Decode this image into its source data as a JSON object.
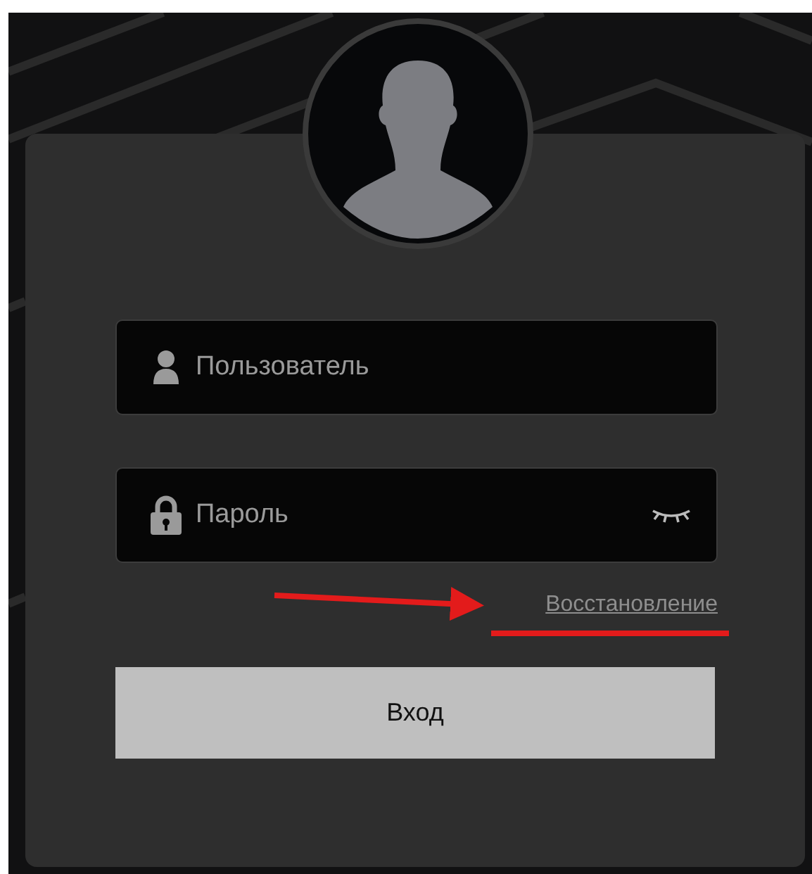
{
  "login_form": {
    "username": {
      "placeholder": "Пользователь"
    },
    "password": {
      "placeholder": "Пароль",
      "show_toggle": true
    },
    "recovery_link": "Восстановление",
    "submit_button": "Вход"
  }
}
